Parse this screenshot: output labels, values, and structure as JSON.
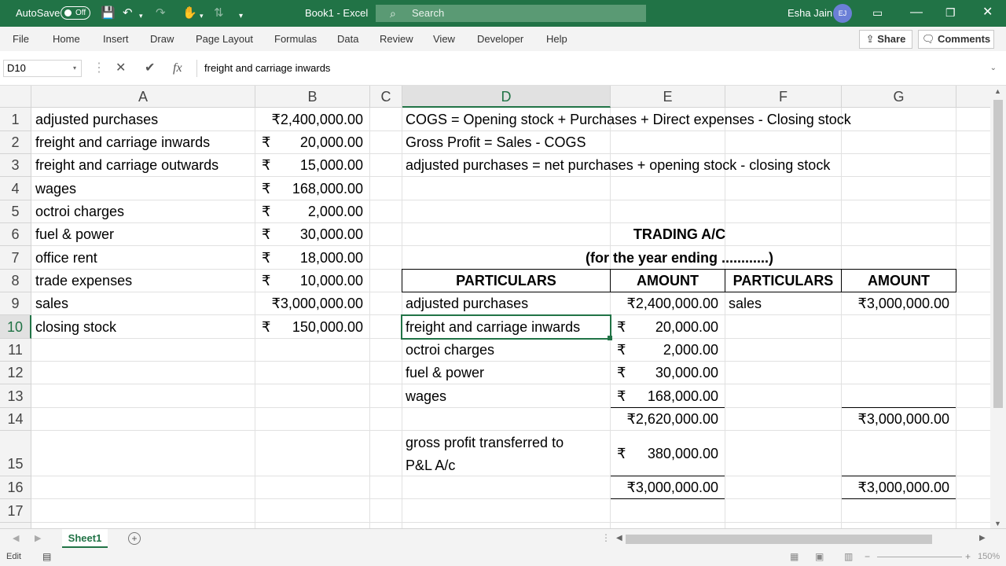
{
  "titlebar": {
    "autosave_label": "AutoSave",
    "autosave_state": "Off",
    "document": "Book1  -  Excel",
    "search_placeholder": "Search",
    "user_name": "Esha Jain",
    "user_initials": "EJ"
  },
  "menu": {
    "tabs": [
      "File",
      "Home",
      "Insert",
      "Draw",
      "Page Layout",
      "Formulas",
      "Data",
      "Review",
      "View",
      "Developer",
      "Help"
    ],
    "share": "Share",
    "comments": "Comments"
  },
  "formula_bar": {
    "namebox": "D10",
    "fx": "fx",
    "content": "freight and carriage inwards"
  },
  "columns": [
    "A",
    "B",
    "C",
    "D",
    "E",
    "F",
    "G"
  ],
  "rows": [
    "1",
    "2",
    "3",
    "4",
    "5",
    "6",
    "7",
    "8",
    "9",
    "10",
    "11",
    "12",
    "13",
    "14",
    "15",
    "16",
    "17"
  ],
  "currency_symbol": "₹",
  "data_list": [
    {
      "label": "adjusted purchases",
      "amount": "₹2,400,000.00"
    },
    {
      "label": "freight and carriage inwards",
      "amount": "20,000.00"
    },
    {
      "label": "freight and carriage outwards",
      "amount": "15,000.00"
    },
    {
      "label": "wages",
      "amount": "168,000.00"
    },
    {
      "label": "octroi charges",
      "amount": "2,000.00"
    },
    {
      "label": "fuel & power",
      "amount": "30,000.00"
    },
    {
      "label": "office rent",
      "amount": "18,000.00"
    },
    {
      "label": "trade expenses",
      "amount": "10,000.00"
    },
    {
      "label": "sales",
      "amount": "₹3,000,000.00"
    },
    {
      "label": "closing stock",
      "amount": "150,000.00"
    }
  ],
  "formulas": {
    "cogs": "COGS = Opening stock + Purchases + Direct expenses - Closing stock",
    "gross_profit": "Gross Profit = Sales - COGS",
    "adjusted_purchases": "adjusted purchases = net purchases + opening stock - closing stock"
  },
  "trading": {
    "title": "TRADING A/C",
    "subtitle": "(for the year ending ............)",
    "headers": {
      "particulars": "PARTICULARS",
      "amount": "AMOUNT"
    },
    "debit": [
      {
        "label": "adjusted purchases",
        "amount": "₹2,400,000.00"
      },
      {
        "label": "freight and carriage inwards",
        "amount": "20,000.00"
      },
      {
        "label": "octroi charges",
        "amount": "2,000.00"
      },
      {
        "label": "fuel & power",
        "amount": "30,000.00"
      },
      {
        "label": "wages",
        "amount": "168,000.00"
      }
    ],
    "subtotal_debit": "₹2,620,000.00",
    "gross_profit_label_1": "gross profit transferred to",
    "gross_profit_label_2": "P&L A/c",
    "gross_profit_amount": "380,000.00",
    "credit_label": "sales",
    "credit_amount": "₹3,000,000.00",
    "subtotal_credit": "₹3,000,000.00",
    "total_debit": "₹3,000,000.00",
    "total_credit": "₹3,000,000.00"
  },
  "sheet_tab": "Sheet1",
  "status": {
    "mode": "Edit",
    "zoom": "150%"
  }
}
